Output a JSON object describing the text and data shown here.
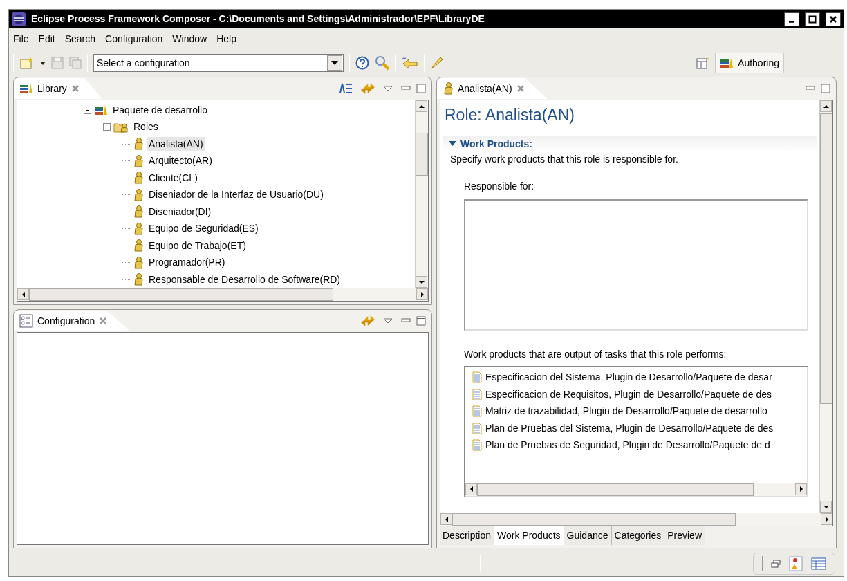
{
  "window": {
    "title": "Eclipse Process Framework Composer - C:\\Documents and Settings\\Administrador\\EPF\\LibraryDE"
  },
  "menu": [
    "File",
    "Edit",
    "Search",
    "Configuration",
    "Window",
    "Help"
  ],
  "toolbar": {
    "save_disabled": true,
    "configuration_combo": {
      "value": "Select a configuration"
    },
    "perspective": {
      "label": "Authoring",
      "selected": true
    }
  },
  "library_view": {
    "tab": "Library",
    "tree": [
      {
        "label": "Paquete de desarrollo",
        "kind": "package",
        "expanded": true,
        "selected": false,
        "children": [
          {
            "label": "Roles",
            "kind": "folder",
            "expanded": true,
            "selected": false,
            "children": [
              {
                "label": "Analista(AN)",
                "kind": "role",
                "selected": true
              },
              {
                "label": "Arquitecto(AR)",
                "kind": "role",
                "selected": false
              },
              {
                "label": "Cliente(CL)",
                "kind": "role",
                "selected": false
              },
              {
                "label": "Diseniador de la Interfaz de Usuario(DU)",
                "kind": "role",
                "selected": false
              },
              {
                "label": "Diseniador(DI)",
                "kind": "role",
                "selected": false
              },
              {
                "label": "Equipo de Seguridad(ES)",
                "kind": "role",
                "selected": false
              },
              {
                "label": "Equipo de Trabajo(ET)",
                "kind": "role",
                "selected": false
              },
              {
                "label": "Programador(PR)",
                "kind": "role",
                "selected": false
              },
              {
                "label": "Responsable de Desarrollo de Software(RD)",
                "kind": "role",
                "selected": false
              }
            ]
          }
        ]
      }
    ]
  },
  "configuration_view": {
    "tab": "Configuration"
  },
  "editor": {
    "tab": "Analista(AN)",
    "heading": "Role: Analista(AN)",
    "section": {
      "title": "Work Products:",
      "expanded": true,
      "description": "Specify work products that this role is responsible for.",
      "responsible_label": "Responsible for:",
      "output_label": "Work products that are output of tasks that this role performs:",
      "outputs": [
        "Especificacion del Sistema, Plugin de Desarrollo/Paquete de desar",
        "Especificacion de Requisitos, Plugin de Desarrollo/Paquete de des",
        "Matriz de trazabilidad, Plugin de Desarrollo/Paquete de desarrollo",
        "Plan de Pruebas del Sistema, Plugin de Desarrollo/Paquete de des",
        "Plan de Pruebas de Seguridad, Plugin de Desarrollo/Paquete de d"
      ]
    },
    "bottom_tabs": [
      {
        "label": "Description",
        "selected": false
      },
      {
        "label": "Work Products",
        "selected": true
      },
      {
        "label": "Guidance",
        "selected": false
      },
      {
        "label": "Categories",
        "selected": false
      },
      {
        "label": "Preview",
        "selected": false
      }
    ]
  }
}
